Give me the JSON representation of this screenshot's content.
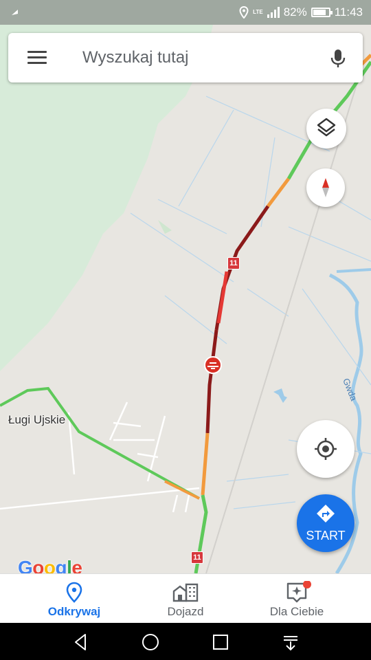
{
  "status_bar": {
    "battery_percent": "82%",
    "battery_level": 0.82,
    "time": "11:43",
    "network": "LTE"
  },
  "search": {
    "placeholder": "Wyszukaj tutaj"
  },
  "map": {
    "place_label": "Ługi Ujskie",
    "river_label": "Gwda",
    "road_number_1": "11",
    "road_number_2": "11",
    "logo_text": "Google",
    "logo_colors": [
      "#4285F4",
      "#EA4335",
      "#FBBC05",
      "#4285F4",
      "#34A853",
      "#EA4335"
    ],
    "traffic_colors": {
      "heavy": "#8b1a1a",
      "slow": "#e53935",
      "moderate": "#f29a3d",
      "free": "#5ec95a"
    }
  },
  "start_button": {
    "label": "START"
  },
  "bottom_nav": {
    "items": [
      {
        "label": "Odkrywaj",
        "icon": "explore-pin-icon",
        "active": true
      },
      {
        "label": "Dojazd",
        "icon": "commute-icon",
        "active": false
      },
      {
        "label": "Dla Ciebie",
        "icon": "for-you-icon",
        "active": false
      }
    ]
  },
  "colors": {
    "accent": "#1a73e8",
    "notification_dot": "#ea4335"
  }
}
